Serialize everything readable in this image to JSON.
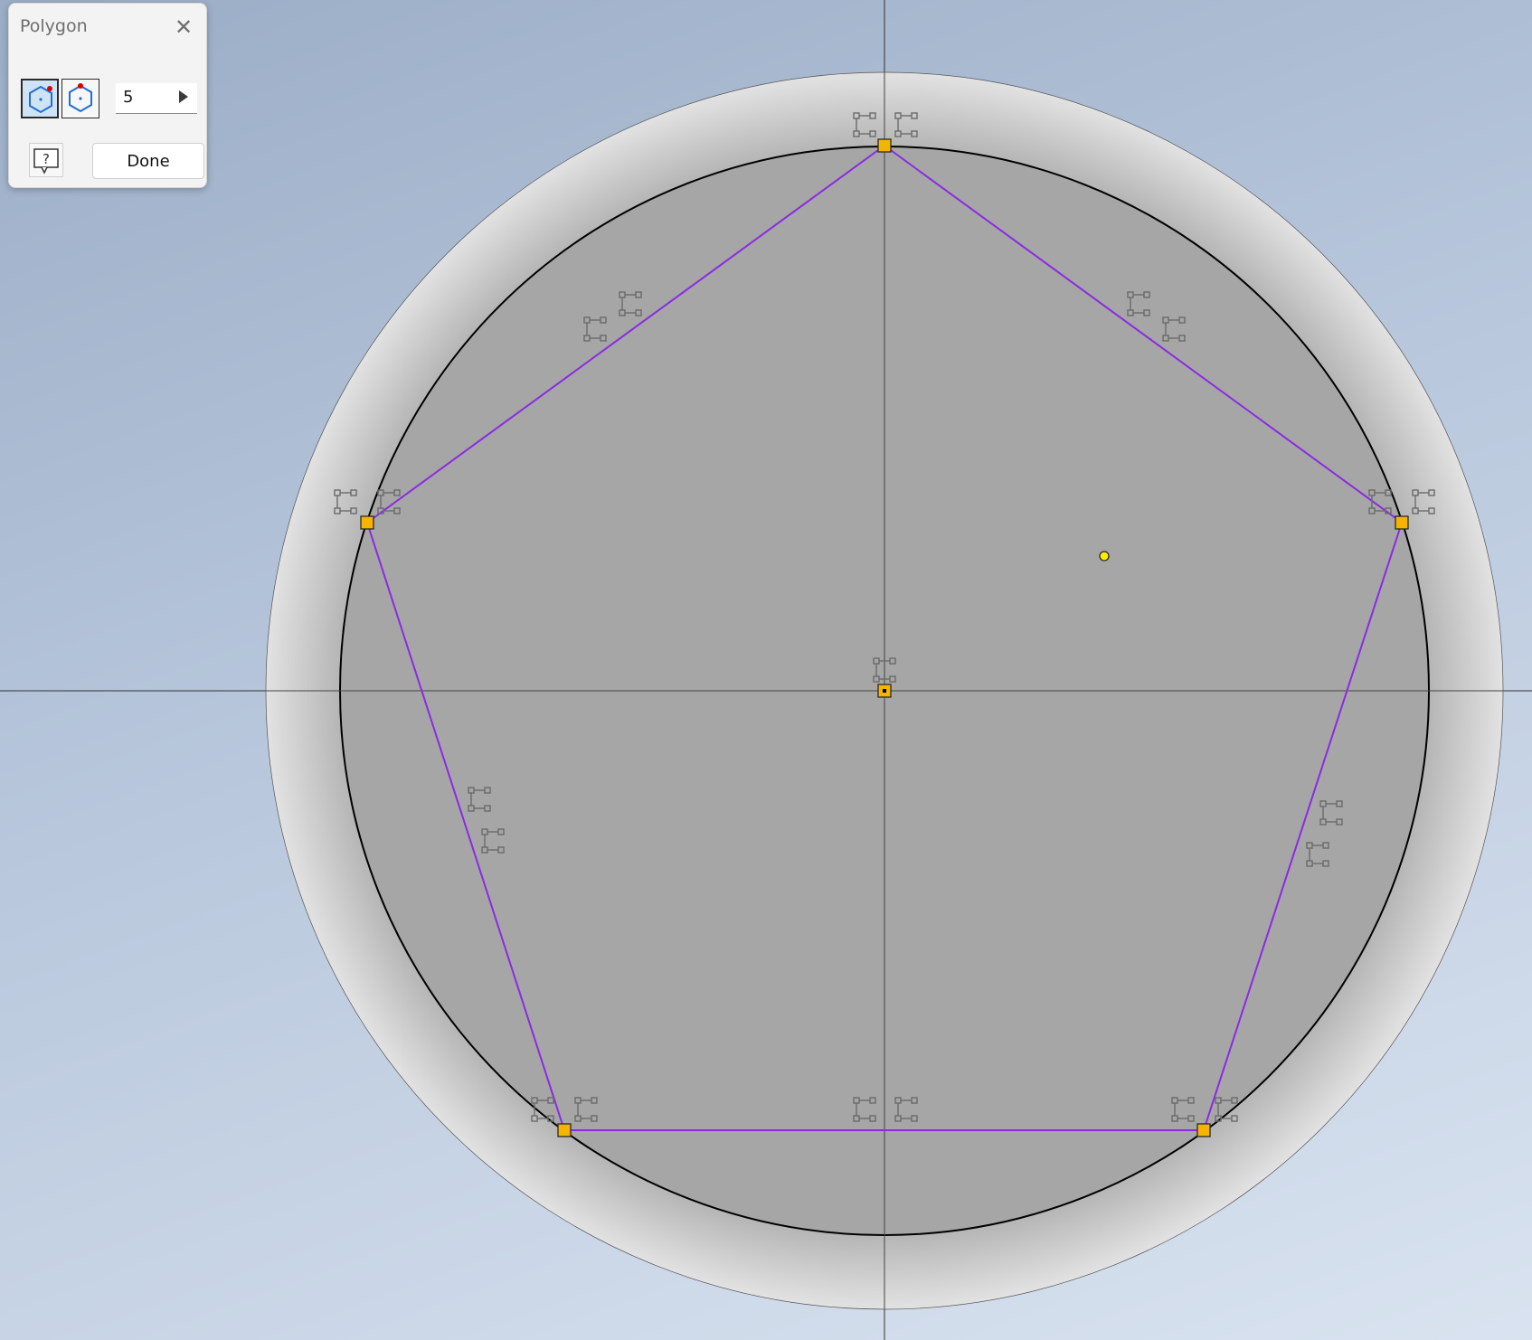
{
  "dialog": {
    "title": "Polygon",
    "close_icon": "close-icon",
    "modes": [
      {
        "name": "inscribed-polygon",
        "icon": "inscribed-polygon-icon",
        "active": true
      },
      {
        "name": "circumscribed-polygon",
        "icon": "circumscribed-polygon-icon",
        "active": false
      }
    ],
    "sides": "5",
    "help_icon": "help-icon",
    "done_label": "Done"
  },
  "sketch": {
    "polygon_color": "#8a2be2",
    "circle_color": "#000000",
    "point_color": "#f4b400",
    "cursor_point_color": "#ffec00",
    "body_fill": "#a6a6a6",
    "axis_color": "#333333"
  }
}
